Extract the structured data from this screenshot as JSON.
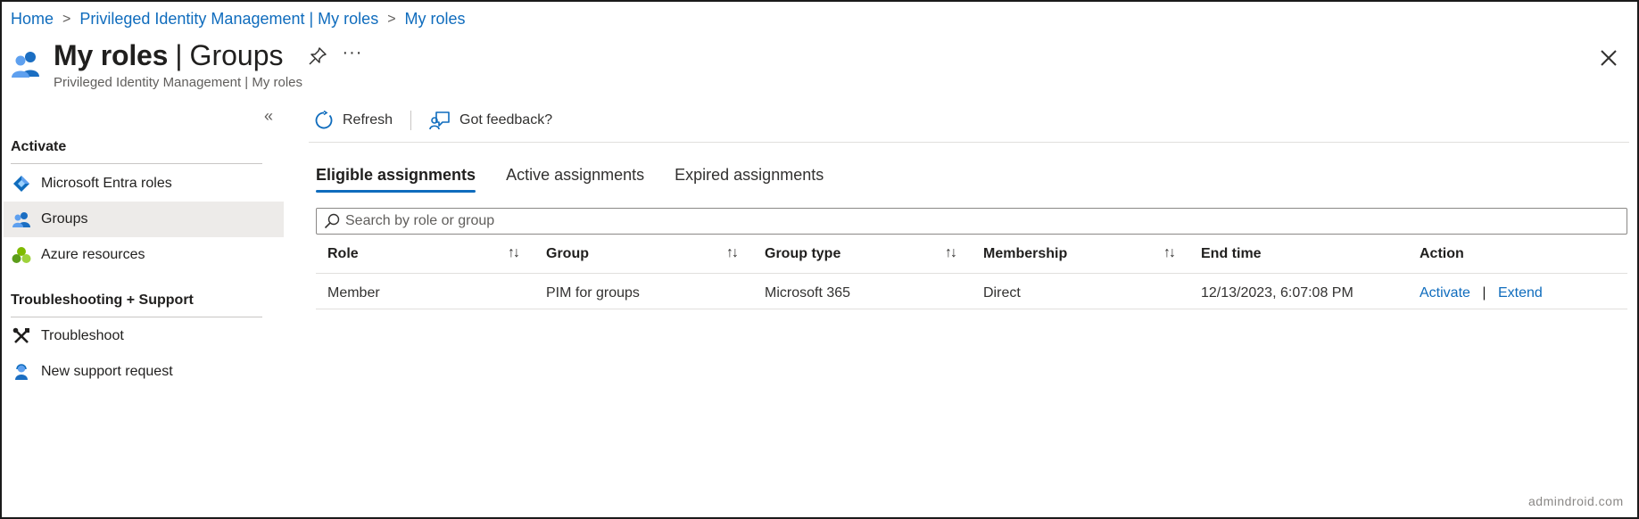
{
  "breadcrumb": {
    "items": [
      "Home",
      "Privileged Identity Management | My roles",
      "My roles"
    ],
    "separator": ">"
  },
  "header": {
    "title_main": "My roles",
    "title_divider": "|",
    "title_sub": "Groups",
    "subtitle": "Privileged Identity Management | My roles",
    "more_label": "···",
    "icons": {
      "page": "users-icon",
      "pin": "pin-icon",
      "close": "close-icon"
    }
  },
  "sidebar": {
    "collapse_label": "«",
    "sections": [
      {
        "heading": "Activate",
        "items": [
          {
            "label": "Microsoft Entra roles",
            "icon": "entra-diamond-icon",
            "active": false
          },
          {
            "label": "Groups",
            "icon": "groups-icon",
            "active": true
          },
          {
            "label": "Azure resources",
            "icon": "azure-resources-icon",
            "active": false
          }
        ]
      },
      {
        "heading": "Troubleshooting + Support",
        "items": [
          {
            "label": "Troubleshoot",
            "icon": "wrench-screwdriver-icon",
            "active": false
          },
          {
            "label": "New support request",
            "icon": "support-person-icon",
            "active": false
          }
        ]
      }
    ]
  },
  "toolbar": {
    "refresh_label": "Refresh",
    "feedback_label": "Got feedback?"
  },
  "tabs": [
    {
      "label": "Eligible assignments",
      "active": true
    },
    {
      "label": "Active assignments",
      "active": false
    },
    {
      "label": "Expired assignments",
      "active": false
    }
  ],
  "search": {
    "placeholder": "Search by role or group",
    "value": ""
  },
  "table": {
    "columns": [
      "Role",
      "Group",
      "Group type",
      "Membership",
      "End time",
      "Action"
    ],
    "sort_glyph": "↑↓",
    "rows": [
      {
        "role": "Member",
        "group": "PIM for groups",
        "group_type": "Microsoft 365",
        "membership": "Direct",
        "end_time": "12/13/2023, 6:07:08 PM",
        "actions": [
          "Activate",
          "Extend"
        ],
        "action_separator": "|"
      }
    ]
  },
  "watermark": "admindroid.com",
  "colors": {
    "link": "#0f6cbd",
    "active_tab_underline": "#0f6cbd",
    "active_sidebar_bg": "#edebe9",
    "text": "#323130"
  }
}
